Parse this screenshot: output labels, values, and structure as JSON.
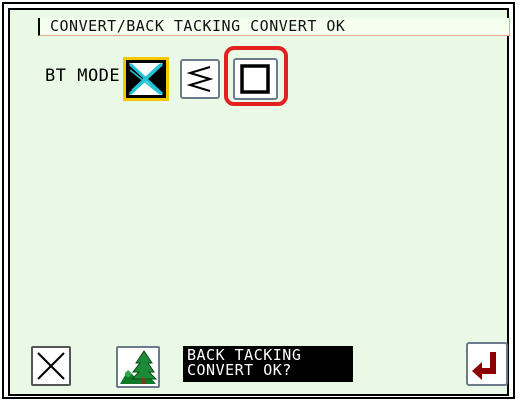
{
  "header": {
    "title": "CONVERT/BACK TACKING CONVERT OK"
  },
  "bt_mode": {
    "label": "BT MODE",
    "options": [
      {
        "icon": "cross-stitch-icon",
        "selected": true
      },
      {
        "icon": "zigzag-icon",
        "selected": false
      },
      {
        "icon": "square-frame-icon",
        "selected": false,
        "highlighted": true
      }
    ]
  },
  "footer": {
    "prompt_line1": "BACK TACKING",
    "prompt_line2": "CONVERT OK?",
    "cancel_icon": "close-icon",
    "tree_icon": "tree-landscape-icon",
    "enter_icon": "enter-return-icon"
  },
  "colors": {
    "panel_background": "#eaf8e6",
    "highlight_red": "#e22020",
    "selected_border": "#f5c800",
    "enter_arrow": "#8b0000",
    "cross_cyan": "#23c3d6"
  }
}
